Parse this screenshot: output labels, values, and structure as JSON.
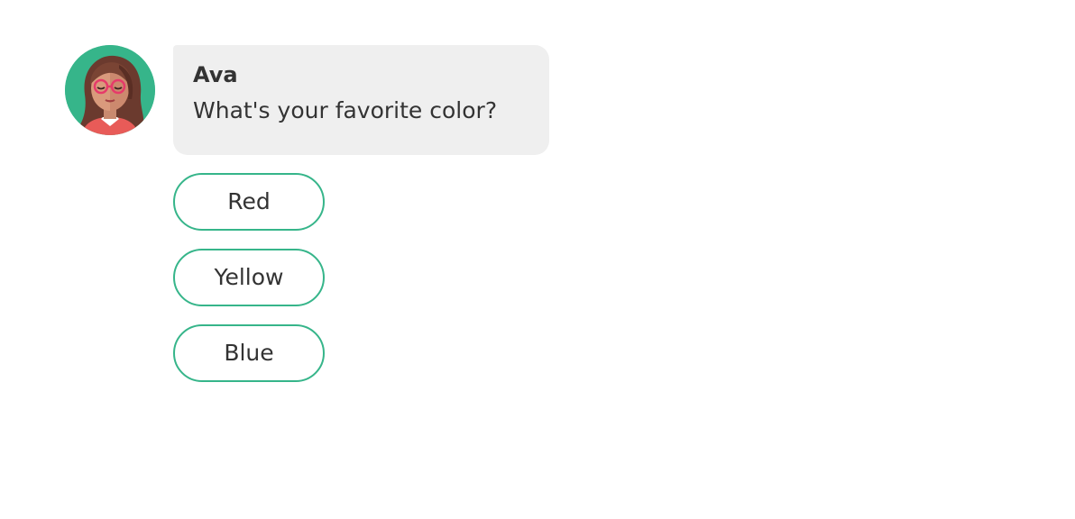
{
  "chat": {
    "avatar": {
      "icon": "woman-with-glasses-avatar",
      "background_color": "#36b58a"
    },
    "bubble": {
      "sender": "Ava",
      "text": "What's your favorite color?",
      "background_color": "#efefef"
    },
    "options": [
      {
        "label": "Red"
      },
      {
        "label": "Yellow"
      },
      {
        "label": "Blue"
      }
    ],
    "accent_color": "#36b58a"
  }
}
